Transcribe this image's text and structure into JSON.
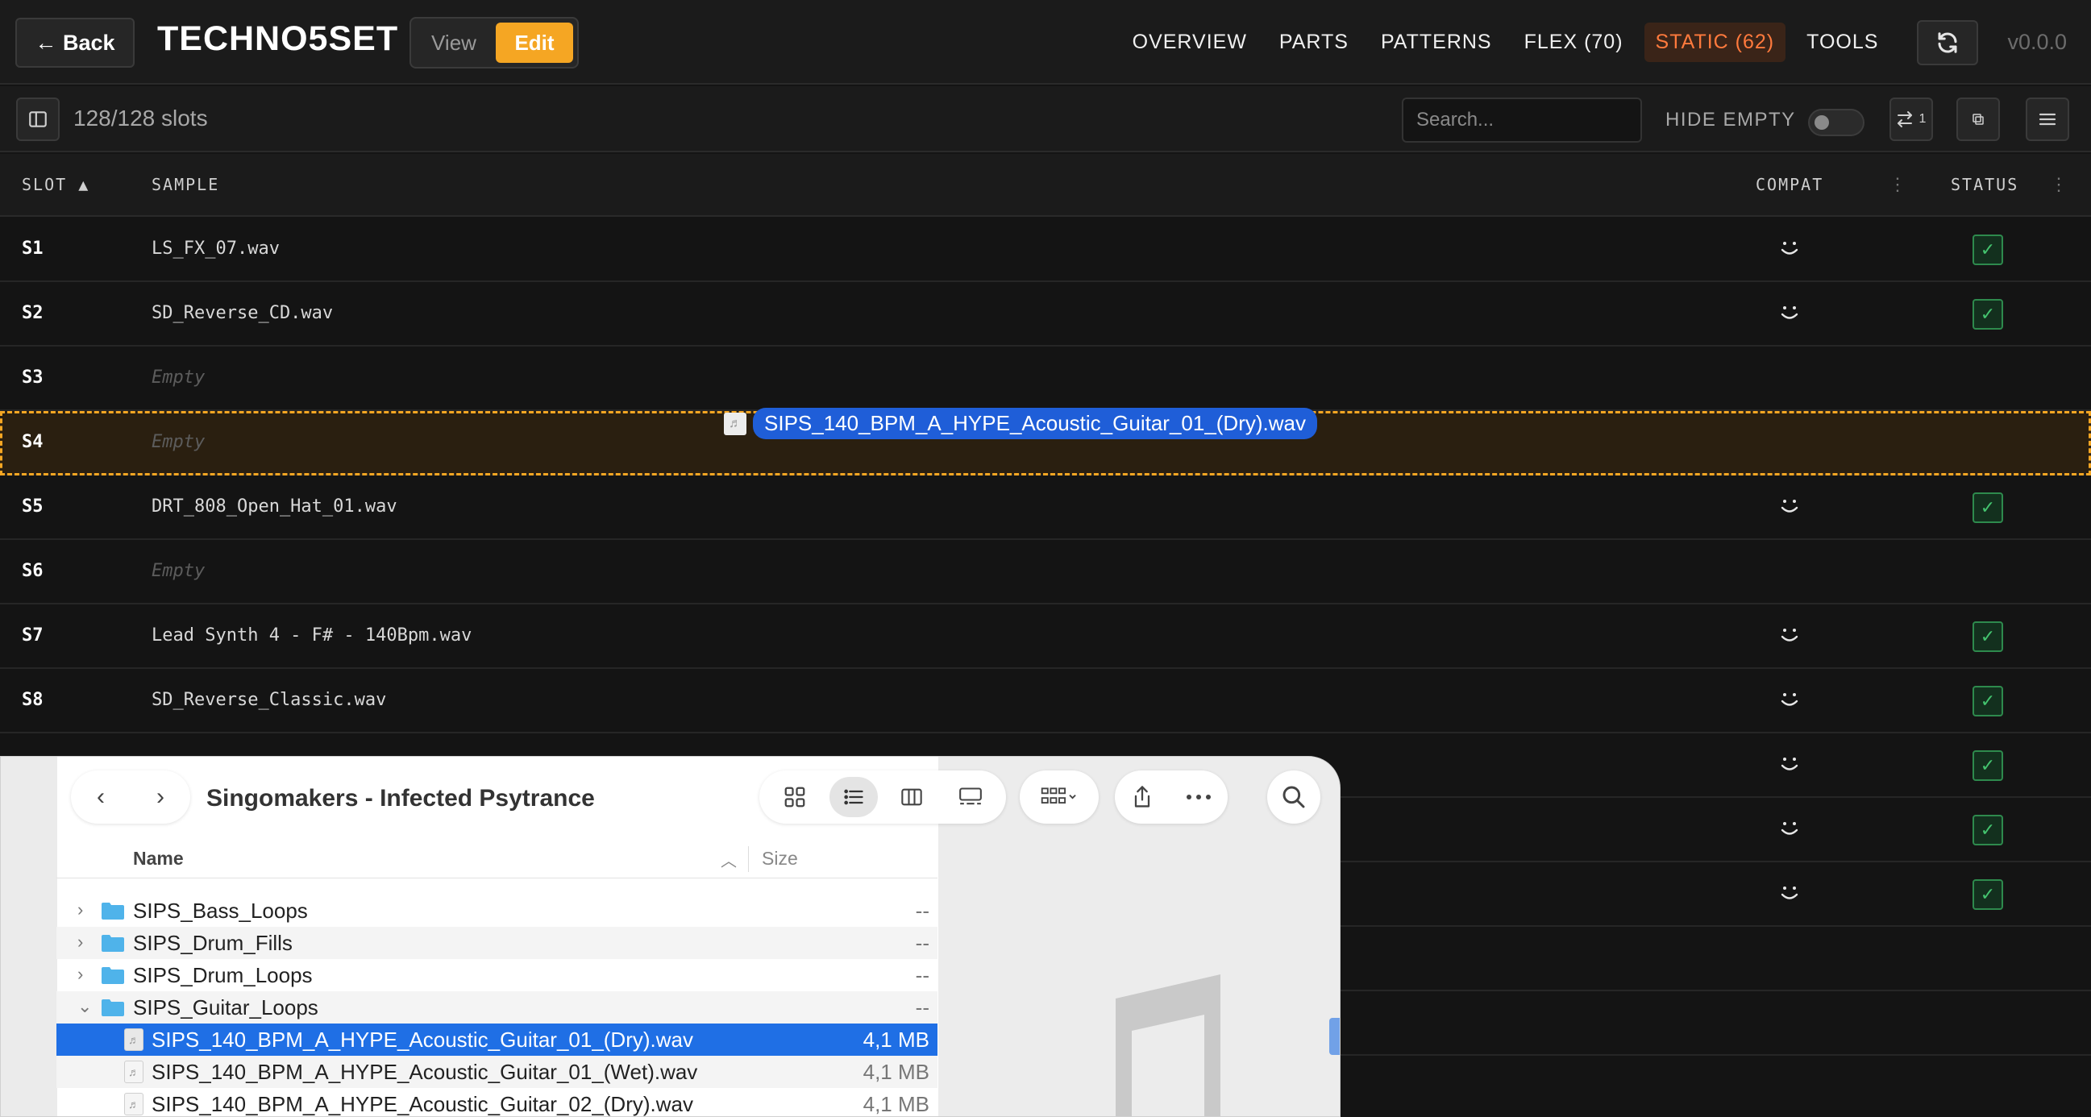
{
  "header": {
    "back_label": "← Back",
    "title": "TECHNO5SET",
    "mode": {
      "view_label": "View",
      "edit_label": "Edit",
      "active": "Edit"
    },
    "nav": [
      {
        "label": "OVERVIEW"
      },
      {
        "label": "PARTS"
      },
      {
        "label": "PATTERNS"
      },
      {
        "label": "FLEX (70)"
      },
      {
        "label": "STATIC (62)",
        "active": true
      },
      {
        "label": "TOOLS"
      }
    ],
    "refresh_icon": "refresh-icon",
    "version": "v0.0.0"
  },
  "toolbar": {
    "slot_count": "128/128 slots",
    "search_placeholder": "Search...",
    "hide_empty_label": "HIDE EMPTY",
    "hide_empty_on": false,
    "swap_badge": "1"
  },
  "table": {
    "columns": {
      "slot": "SLOT ▲",
      "sample": "SAMPLE",
      "compat": "COMPAT",
      "status": "STATUS"
    },
    "rows": [
      {
        "slot": "S1",
        "sample": "LS_FX_07.wav",
        "empty": false,
        "ok": true
      },
      {
        "slot": "S2",
        "sample": "SD_Reverse_CD.wav",
        "empty": false,
        "ok": true
      },
      {
        "slot": "S3",
        "sample": "Empty",
        "empty": true,
        "ok": false
      },
      {
        "slot": "S4",
        "sample": "Empty",
        "empty": true,
        "ok": false,
        "drop_target": true
      },
      {
        "slot": "S5",
        "sample": "DRT_808_Open_Hat_01.wav",
        "empty": false,
        "ok": true
      },
      {
        "slot": "S6",
        "sample": "Empty",
        "empty": true,
        "ok": false
      },
      {
        "slot": "S7",
        "sample": "Lead Synth 4 - F# - 140Bpm.wav",
        "empty": false,
        "ok": true
      },
      {
        "slot": "S8",
        "sample": "SD_Reverse_Classic.wav",
        "empty": false,
        "ok": true
      },
      {
        "slot": "",
        "sample": "",
        "empty": false,
        "ok": true
      },
      {
        "slot": "",
        "sample": "",
        "empty": false,
        "ok": true
      },
      {
        "slot": "",
        "sample": "",
        "empty": false,
        "ok": true
      },
      {
        "slot": "",
        "sample": "",
        "empty": true,
        "ok": false
      },
      {
        "slot": "",
        "sample": "",
        "empty": true,
        "ok": false
      }
    ],
    "status_check": "✓"
  },
  "drag": {
    "file_name": "SIPS_140_BPM_A_HYPE_Acoustic_Guitar_01_(Dry).wav"
  },
  "finder": {
    "title": "Singomakers - Infected Psytrance",
    "columns": {
      "name": "Name",
      "size": "Size"
    },
    "items": [
      {
        "type": "folder",
        "name": "SIPS_Bass_Loops",
        "size": "--",
        "expanded": false
      },
      {
        "type": "folder",
        "name": "SIPS_Drum_Fills",
        "size": "--",
        "expanded": false
      },
      {
        "type": "folder",
        "name": "SIPS_Drum_Loops",
        "size": "--",
        "expanded": false
      },
      {
        "type": "folder",
        "name": "SIPS_Guitar_Loops",
        "size": "--",
        "expanded": true
      },
      {
        "type": "file",
        "name": "SIPS_140_BPM_A_HYPE_Acoustic_Guitar_01_(Dry).wav",
        "size": "4,1 MB",
        "selected": true
      },
      {
        "type": "file",
        "name": "SIPS_140_BPM_A_HYPE_Acoustic_Guitar_01_(Wet).wav",
        "size": "4,1 MB"
      },
      {
        "type": "file",
        "name": "SIPS_140_BPM_A_HYPE_Acoustic_Guitar_02_(Dry).wav",
        "size": "4,1 MB"
      }
    ]
  },
  "colors": {
    "accent": "#f5a623",
    "active_tab": "#ff7a3d",
    "status_ok": "#44c46f",
    "selection": "#1f6fe5"
  }
}
